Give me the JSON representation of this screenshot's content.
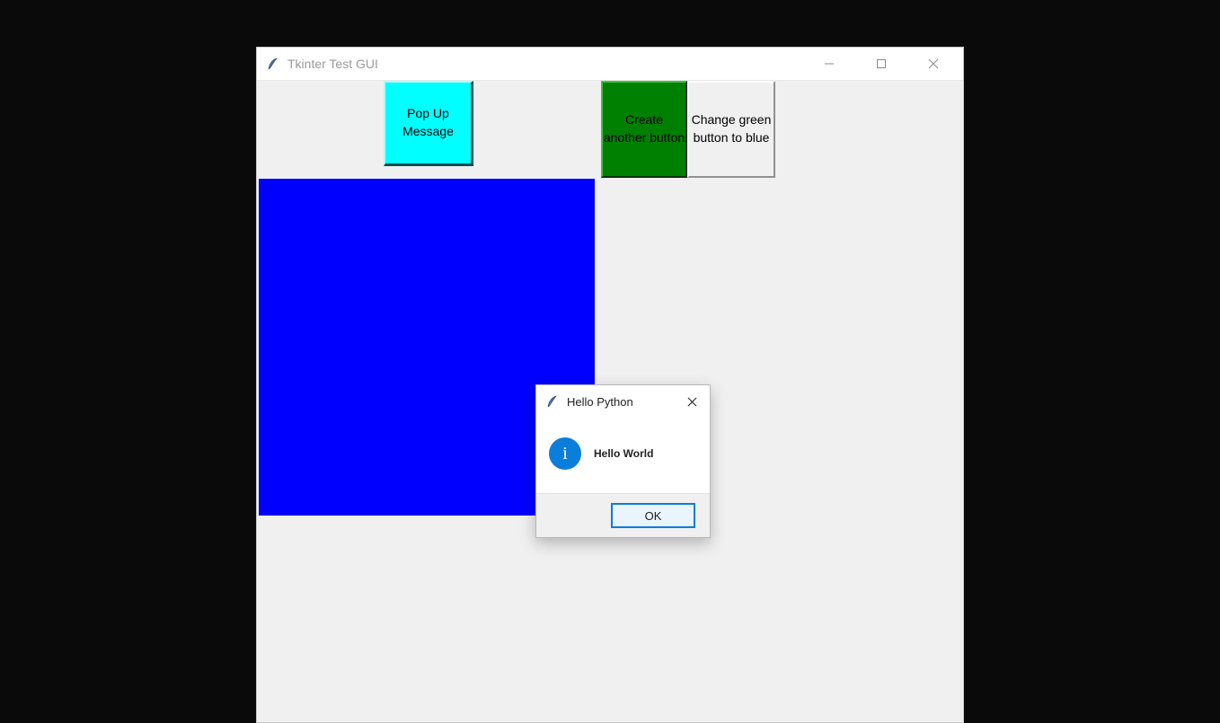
{
  "window": {
    "title": "Tkinter Test GUI"
  },
  "buttons": {
    "popup": "Pop Up Message",
    "create_another": "Create another button",
    "change_blue": "Change green button to blue"
  },
  "dialog": {
    "title": "Hello Python",
    "message": "Hello World",
    "ok": "OK"
  },
  "info_glyph": "i",
  "colors": {
    "cyan": "#00ffff",
    "green": "#008000",
    "blue_canvas": "#0000ff",
    "accent": "#0b7dda"
  }
}
